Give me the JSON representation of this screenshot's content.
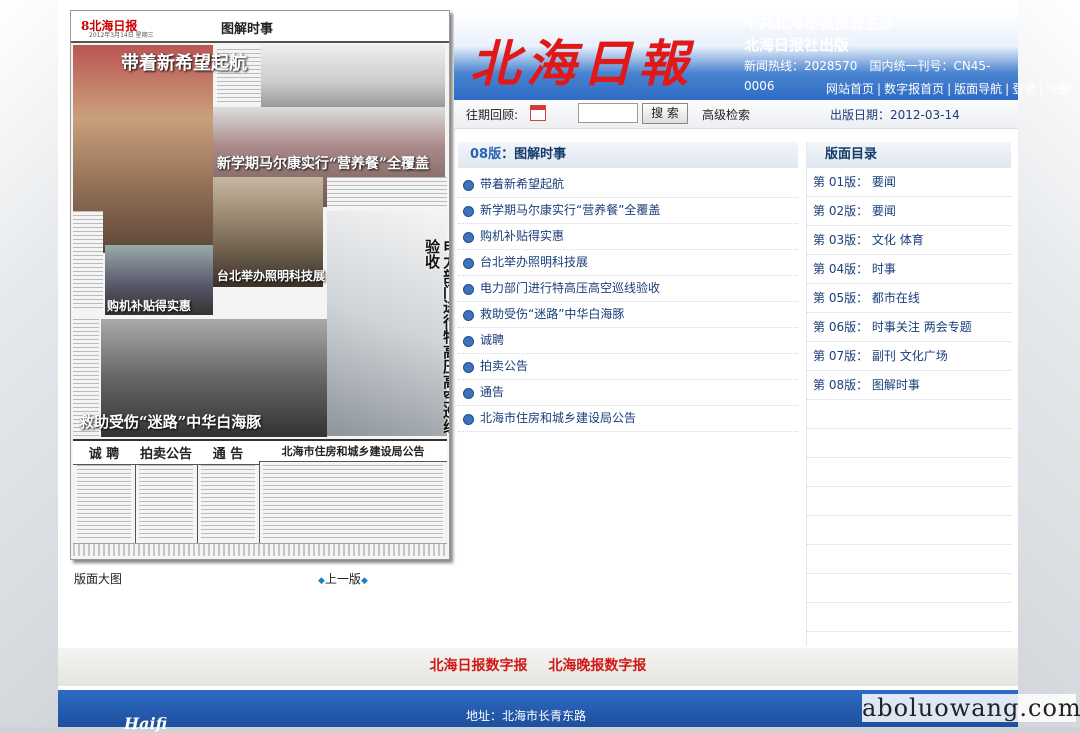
{
  "paper": {
    "logo": "8北海日报",
    "date_line": "2012年3月14日 星期三",
    "section": "图解时事",
    "headlines": {
      "h1": "带着新希望起航",
      "h2": "新学期马尔康实行“营养餐”全覆盖",
      "h3": "购机补贴得实惠",
      "h4": "台北举办照明科技展",
      "h5": "电力部门进行特高压高空巡线验收",
      "h6": "救助受伤“迷路”中华白海豚"
    },
    "ads": [
      "诚 聘",
      "拍卖公告",
      "通 告",
      "北海市住房和城乡建设局公告"
    ]
  },
  "below_paper": {
    "big_image": "版面大图",
    "prev": "上一版"
  },
  "header": {
    "brand": "北海日報",
    "line1": "中共北海市委员会主办",
    "line2": "北海日报社出版",
    "line3": "新闻热线：2028570　国内统一刊号：CN45-0006",
    "links": [
      "网站首页",
      "数字报首页",
      "版面导航",
      "登录",
      "注册"
    ]
  },
  "toolbar": {
    "past_label": "往期回顾:",
    "search_button": "搜 索",
    "advanced": "高级检索",
    "pub_date": "出版日期：2012-03-14"
  },
  "articles": {
    "title_num": "08版",
    "title_sep": "：",
    "title_name": "图解时事",
    "items": [
      "带着新希望起航",
      "新学期马尔康实行“营养餐”全覆盖",
      "购机补贴得实惠",
      "台北举办照明科技展",
      "电力部门进行特高压高空巡线验收",
      "救助受伤“迷路”中华白海豚",
      "诚聘",
      "拍卖公告",
      "通告",
      "北海市住房和城乡建设局公告"
    ]
  },
  "toc": {
    "title": "版面目录",
    "items": [
      "第 01版： 要闻",
      "第 02版： 要闻",
      "第 03版： 文化 体育",
      "第 04版： 时事",
      "第 05版： 都市在线",
      "第 06版： 时事关注 两会专题",
      "第 07版： 副刊 文化广场",
      "第 08版： 图解时事"
    ]
  },
  "footer": {
    "links": [
      "北海日报数字报",
      "北海晚报数字报"
    ],
    "address": "地址：北海市长青东路",
    "logo_fragment": "Haifi"
  },
  "watermark": "aboluowang.com",
  "colors": {
    "brand_red": "#e01818",
    "header_blue": "#2f6bc4",
    "link_blue": "#1a3e7a"
  }
}
